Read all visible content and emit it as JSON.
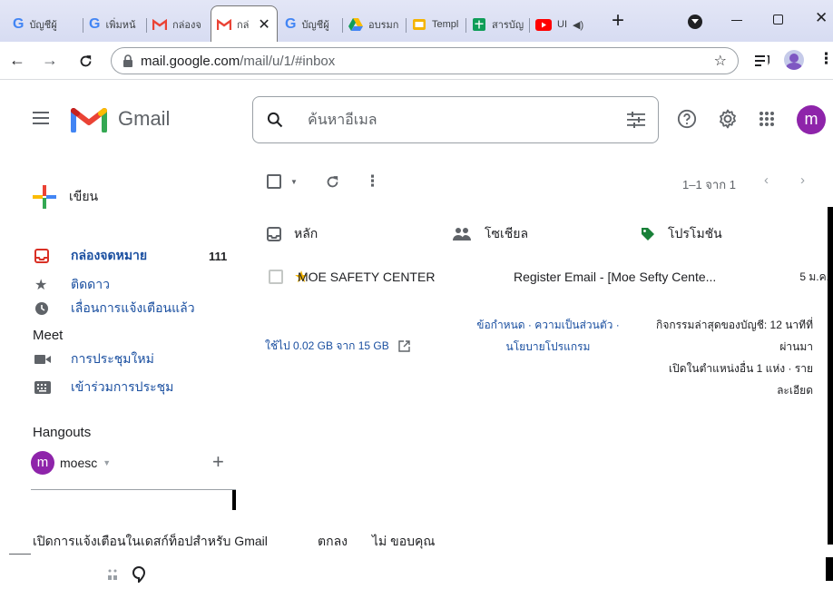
{
  "tabs": [
    {
      "label": "บัญชีผู้",
      "icon": "google-g-icon"
    },
    {
      "label": "เพิ่มหน้",
      "icon": "google-g-icon"
    },
    {
      "label": "กล่องจ",
      "icon": "gmail-icon"
    },
    {
      "label": "กล่",
      "icon": "gmail-icon"
    },
    {
      "label": "บัญชีผู้",
      "icon": "google-g-icon"
    },
    {
      "label": "อบรมก",
      "icon": "drive-icon"
    },
    {
      "label": "Templ",
      "icon": "slides-icon"
    },
    {
      "label": "สารบัญ",
      "icon": "sheets-icon"
    },
    {
      "label": "UI",
      "icon": "youtube-icon"
    }
  ],
  "address": {
    "host": "mail.google.com",
    "path": "/mail/u/1/#inbox"
  },
  "gmail": {
    "brand": "Gmail",
    "search_placeholder": "ค้นหาอีเมล",
    "avatar_letter": "m",
    "compose": "เขียน",
    "nav": [
      {
        "label": "กล่องจดหมาย",
        "count": "111"
      },
      {
        "label": "ติดดาว"
      },
      {
        "label": "เลื่อนการแจ้งเตือนแล้ว"
      }
    ],
    "meet_heading": "Meet",
    "meet_items": [
      "การประชุมใหม่",
      "เข้าร่วมการประชุม"
    ],
    "hangouts_heading": "Hangouts",
    "hangouts_user": "moesc",
    "hangouts_avatar": "m",
    "pagination": "1–1 จาก 1",
    "categories": [
      "หลัก",
      "โซเชียล",
      "โปรโมชัน"
    ],
    "email": {
      "sender": "MOE SAFETY CENTER",
      "subject": "Register Email - [Moe Sefty Cente...",
      "date": "5 ม.ค."
    },
    "storage": "ใช้ไป 0.02 GB จาก 15 GB",
    "terms_line1": "ข้อกำหนด · ความเป็นส่วนตัว ·",
    "terms_line2": "นโยบายโปรแกรม",
    "activity_line1": "กิจกรรมล่าสุดของบัญชี: 12 นาทีที่",
    "activity_line2": "ผ่านมา",
    "activity_line3": "เปิดในตำแหน่งอื่น 1 แห่ง · ราย",
    "activity_line4": "ละเอียด",
    "notify_text": "เปิดการแจ้งเตือนในเดสก์ท็อปสำหรับ Gmail",
    "notify_ok": "ตกลง",
    "notify_no": "ไม่ ขอบคุณ"
  },
  "colors": {
    "accent_blue": "#1a73e8",
    "gmail_red": "#ea4335",
    "star_yellow": "#f4b400",
    "avatar_purple": "#8e24aa"
  }
}
